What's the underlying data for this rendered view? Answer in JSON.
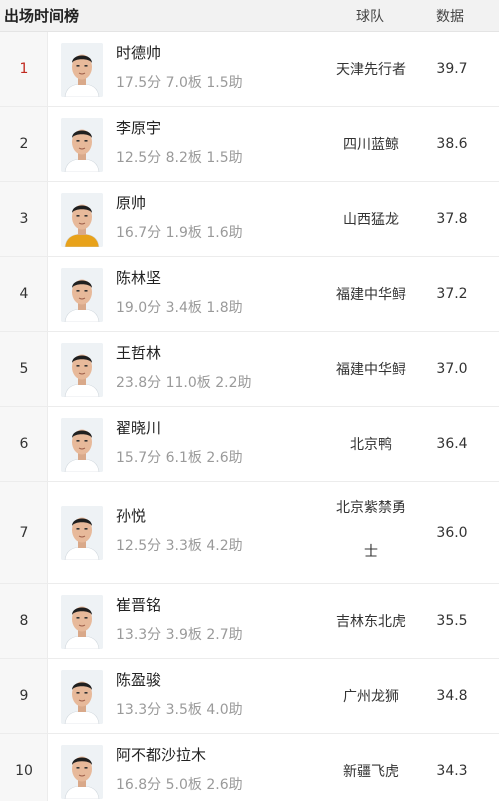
{
  "header": {
    "title": "出场时间榜",
    "col_team": "球队",
    "col_data": "数据"
  },
  "rows": [
    {
      "rank": "1",
      "name": "时德帅",
      "stats": "17.5分 7.0板 1.5助",
      "team": "天津先行者",
      "value": "39.7",
      "jersey": "#ffffff"
    },
    {
      "rank": "2",
      "name": "李原宇",
      "stats": "12.5分 8.2板 1.5助",
      "team": "四川蓝鲸",
      "value": "38.6",
      "jersey": "#ffffff"
    },
    {
      "rank": "3",
      "name": "原帅",
      "stats": "16.7分 1.9板 1.6助",
      "team": "山西猛龙",
      "value": "37.8",
      "jersey": "#e8a21a"
    },
    {
      "rank": "4",
      "name": "陈林坚",
      "stats": "19.0分 3.4板 1.8助",
      "team": "福建中华鲟",
      "value": "37.2",
      "jersey": "#ffffff"
    },
    {
      "rank": "5",
      "name": "王哲林",
      "stats": "23.8分 11.0板 2.2助",
      "team": "福建中华鲟",
      "value": "37.0",
      "jersey": "#ffffff"
    },
    {
      "rank": "6",
      "name": "翟晓川",
      "stats": "15.7分 6.1板 2.6助",
      "team": "北京鸭",
      "value": "36.4",
      "jersey": "#ffffff"
    },
    {
      "rank": "7",
      "name": "孙悦",
      "stats": "12.5分 3.3板 4.2助",
      "team_line1": "北京紫禁勇",
      "team_line2": "士",
      "value": "36.0",
      "jersey": "#ffffff"
    },
    {
      "rank": "8",
      "name": "崔晋铭",
      "stats": "13.3分 3.9板 2.7助",
      "team": "吉林东北虎",
      "value": "35.5",
      "jersey": "#ffffff"
    },
    {
      "rank": "9",
      "name": "陈盈骏",
      "stats": "13.3分 3.5板 4.0助",
      "team": "广州龙狮",
      "value": "34.8",
      "jersey": "#ffffff"
    },
    {
      "rank": "10",
      "name": "阿不都沙拉木",
      "stats": "16.8分 5.0板 2.6助",
      "team": "新疆飞虎",
      "value": "34.3",
      "jersey": "#ffffff"
    }
  ]
}
